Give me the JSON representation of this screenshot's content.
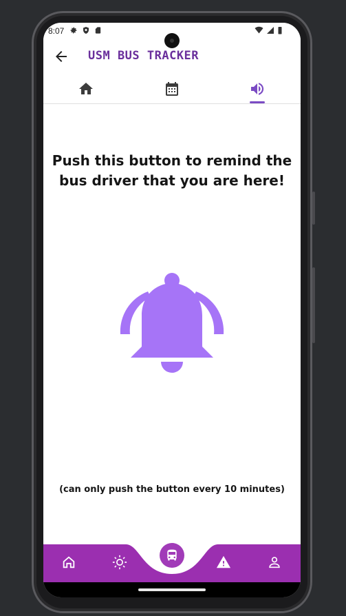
{
  "status_bar": {
    "time": "8:07",
    "left_icons": [
      "settings-icon",
      "shield-icon",
      "sd-card-icon"
    ],
    "right_icons": [
      "wifi-icon",
      "signal-icon",
      "battery-icon"
    ]
  },
  "app_bar": {
    "title": "USM BUS TRACKER",
    "back_icon": "arrow-back-icon"
  },
  "tabs": [
    {
      "name": "home",
      "icon": "home-icon",
      "selected": false
    },
    {
      "name": "schedule",
      "icon": "calendar-icon",
      "selected": false
    },
    {
      "name": "reminder",
      "icon": "volume-icon",
      "selected": true
    }
  ],
  "main": {
    "headline": "Push this button to remind the bus driver that you are here!",
    "bell_icon": "bell-ringing-icon",
    "footnote": "(can only push the button every 10 minutes)"
  },
  "bottom_nav": {
    "items": [
      {
        "name": "home",
        "icon": "home-outline-icon"
      },
      {
        "name": "weather",
        "icon": "sun-icon"
      },
      {
        "name": "bus",
        "icon": "bus-icon"
      },
      {
        "name": "alerts",
        "icon": "warning-icon"
      },
      {
        "name": "profile",
        "icon": "person-icon"
      }
    ]
  },
  "colors": {
    "accent": "#7b4bc4",
    "title": "#6a2f9c",
    "bell": "#a674f7",
    "bottom_nav": "#9b2fb0"
  }
}
